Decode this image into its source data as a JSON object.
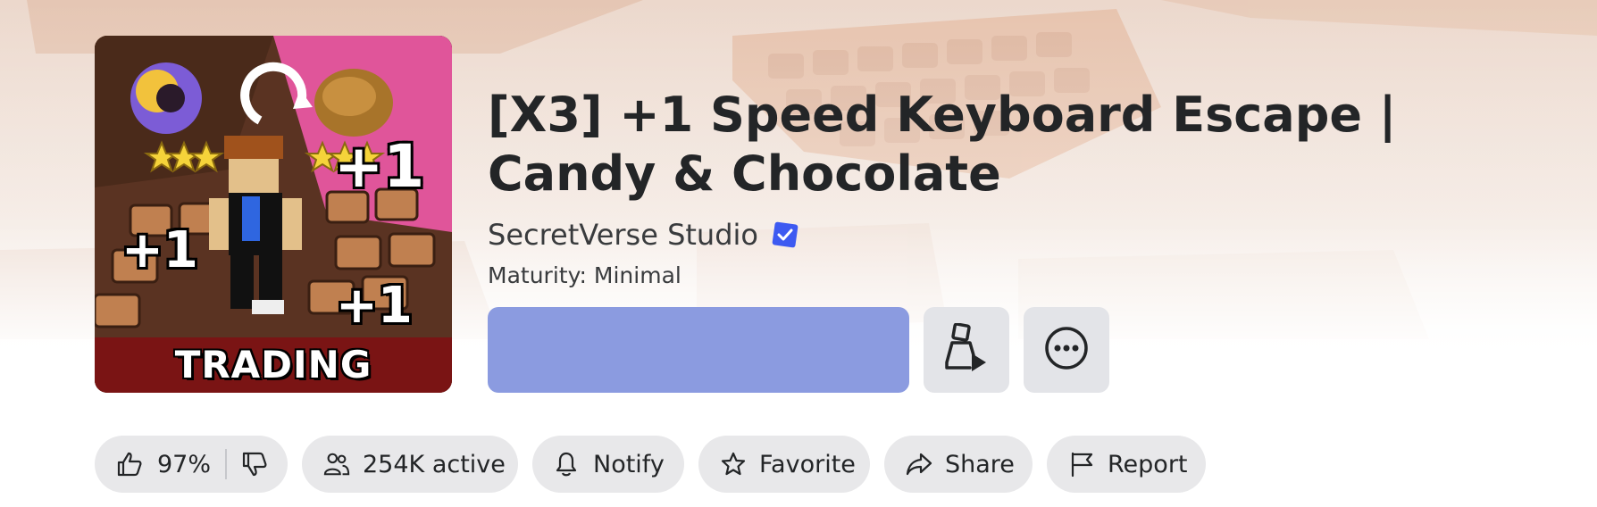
{
  "game": {
    "title": "[X3] +1 Speed Keyboard Escape | Candy & Chocolate",
    "creator": "SecretVerse Studio",
    "maturity": "Maturity: Minimal",
    "thumbnail": {
      "banner_text": "TRADING",
      "plus_labels": [
        "+1",
        "+1",
        "+1"
      ]
    }
  },
  "actions": {
    "play_button_color": "#8b9be0",
    "avatar_icon": "avatar-play-icon",
    "more_icon": "more-options-icon"
  },
  "stats": {
    "rating": "97%",
    "active": "254K active",
    "notify": "Notify",
    "favorite": "Favorite",
    "share": "Share",
    "report": "Report"
  },
  "colors": {
    "verified_badge": "#3d5af1",
    "pill_bg": "#e8e8ea",
    "title_text": "#232527"
  }
}
